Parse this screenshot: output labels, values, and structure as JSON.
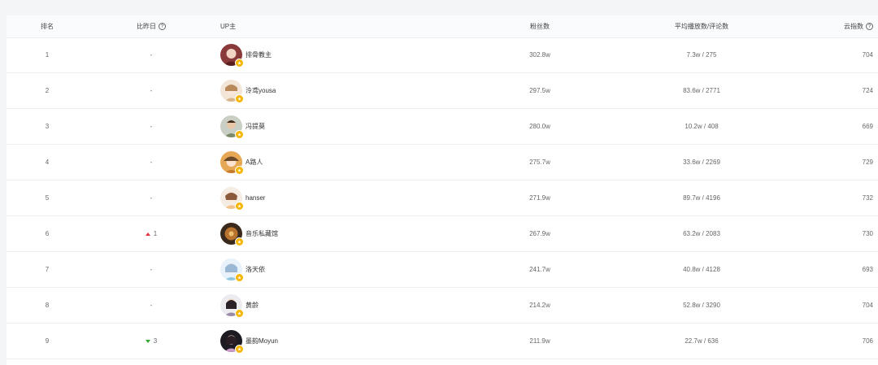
{
  "header": {
    "rank": "排名",
    "change": "比昨日",
    "up": "UP主",
    "fans": "粉丝数",
    "avg": "平均播放数/评论数",
    "cloud": "云指数"
  },
  "colors": {
    "badge": "#f7b500",
    "rise": "#e0343c",
    "fall": "#2eaa2e"
  },
  "rows": [
    {
      "rank": "1",
      "change": "-",
      "name": "排骨教主",
      "fans": "302.8w",
      "avg": "7.3w / 275",
      "cloud": "704"
    },
    {
      "rank": "2",
      "change": "-",
      "name": "泠鸢yousa",
      "fans": "297.5w",
      "avg": "83.6w / 2771",
      "cloud": "724"
    },
    {
      "rank": "3",
      "change": "-",
      "name": "冯提莫",
      "fans": "280.0w",
      "avg": "10.2w / 408",
      "cloud": "669"
    },
    {
      "rank": "4",
      "change": "-",
      "name": "A路人",
      "fans": "275.7w",
      "avg": "33.6w / 2269",
      "cloud": "729"
    },
    {
      "rank": "5",
      "change": "-",
      "name": "hanser",
      "fans": "271.9w",
      "avg": "89.7w / 4196",
      "cloud": "732"
    },
    {
      "rank": "6",
      "change": "1",
      "name": "音乐私藏馆",
      "fans": "267.9w",
      "avg": "63.2w / 2083",
      "cloud": "730"
    },
    {
      "rank": "7",
      "change": "-",
      "name": "洛天依",
      "fans": "241.7w",
      "avg": "40.8w / 4128",
      "cloud": "693"
    },
    {
      "rank": "8",
      "change": "-",
      "name": "黄龄",
      "fans": "214.2w",
      "avg": "52.8w / 3290",
      "cloud": "704"
    },
    {
      "rank": "9",
      "change": "3",
      "name": "墨韵Moyun",
      "fans": "211.9w",
      "avg": "22.7w / 636",
      "cloud": "706"
    }
  ]
}
